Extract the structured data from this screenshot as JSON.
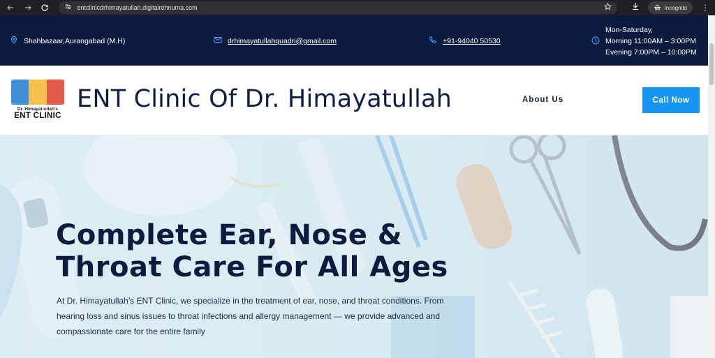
{
  "browser": {
    "url": "entclinicdrhimayatullah.digitalrehnuma.com",
    "incognito_label": "Incognito"
  },
  "topbar": {
    "address": "Shahbazaar,Aurangabad (M.H)",
    "email": "drhimayatullahquadri@gmail.com",
    "phone": "+91-94040 50530",
    "hours_days": "Mon-Saturday,",
    "hours_morning": "Morning 11:00AM – 3:00PM",
    "hours_evening": "Evening 7:00PM – 10:00PM"
  },
  "header": {
    "logo_sub": "Dr. Himayat-ullah's",
    "logo_main": "ENT CLINIC",
    "title": "ENT Clinic Of Dr. Himayatullah",
    "nav_about": "About Us",
    "call_button": "Call Now"
  },
  "hero": {
    "title_line1": "Complete Ear, Nose &",
    "title_line2": "Throat Care For All Ages",
    "text": "At Dr. Himayatullah’s ENT Clinic, we specialize in the treatment of ear, nose, and throat conditions. From hearing loss and sinus issues to throat infections and allergy management — we provide advanced and compassionate care for the entire family"
  },
  "colors": {
    "topbar_bg": "#0c1c3e",
    "accent": "#1596f2",
    "title": "#0d1f45"
  }
}
